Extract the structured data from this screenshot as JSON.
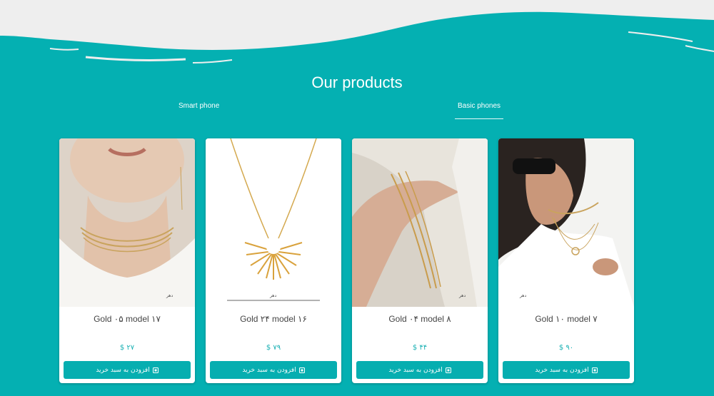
{
  "section": {
    "title": "Our products"
  },
  "tabs": [
    {
      "label": "Smart phone",
      "active": false
    },
    {
      "label": "Basic phones",
      "active": true
    }
  ],
  "products": [
    {
      "name": "Gold ۰۵ model ۱۷",
      "price": "$ ۲۷",
      "button": "افزودن به سبد خرید",
      "image": "necklace choker photo"
    },
    {
      "name": "Gold ۲۴ model ۱۶",
      "price": "$ ۷۹",
      "button": "افزودن به سبد خرید",
      "image": "sun pendant necklace"
    },
    {
      "name": "Gold ۰۴ model ۸",
      "price": "$ ۴۴",
      "button": "افزودن به سبد خرید",
      "image": "bracelet on wrist"
    },
    {
      "name": "Gold ۱۰ model ۷",
      "price": "$ ۹۰",
      "button": "افزودن به سبد خرید",
      "image": "woman with necklaces"
    }
  ],
  "colors": {
    "accent": "#04b0b2",
    "wave": "#eeeeee",
    "button": "#06aeb0",
    "price": "#18b0b3"
  },
  "icons": {
    "cart": "cart-icon"
  }
}
